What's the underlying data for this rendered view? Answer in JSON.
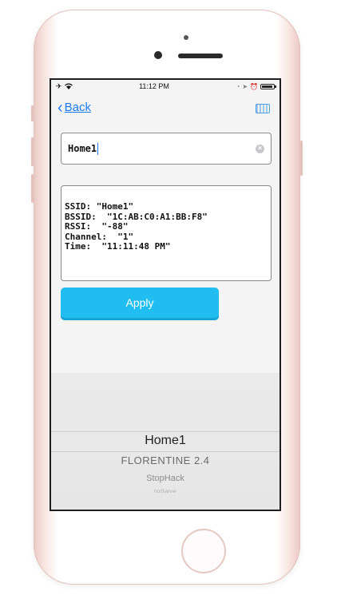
{
  "status_bar": {
    "time": "11:12 PM"
  },
  "nav": {
    "back_label": "Back",
    "icons": [
      "chevron-left-icon",
      "keyboard-icon"
    ]
  },
  "ssid_field": {
    "value": "Home1"
  },
  "network_info": {
    "lines": [
      "SSID: \"Home1\"",
      "BSSID:  \"1C:AB:C0:A1:BB:F8\"",
      "RSSI:  \"-88\"",
      "Channel:  \"1\"",
      "Time:  \"11:11:48 PM\""
    ]
  },
  "apply_button": {
    "label": "Apply"
  },
  "picker": {
    "items": [
      "Home1",
      "FLORENTINE 2.4",
      "StopHack",
      "toSave"
    ],
    "selected": "Home1"
  },
  "colors": {
    "accent_blue": "#1a7cf2",
    "apply_button": "#1fbdf0",
    "phone_frame": "#e9c9c3"
  }
}
